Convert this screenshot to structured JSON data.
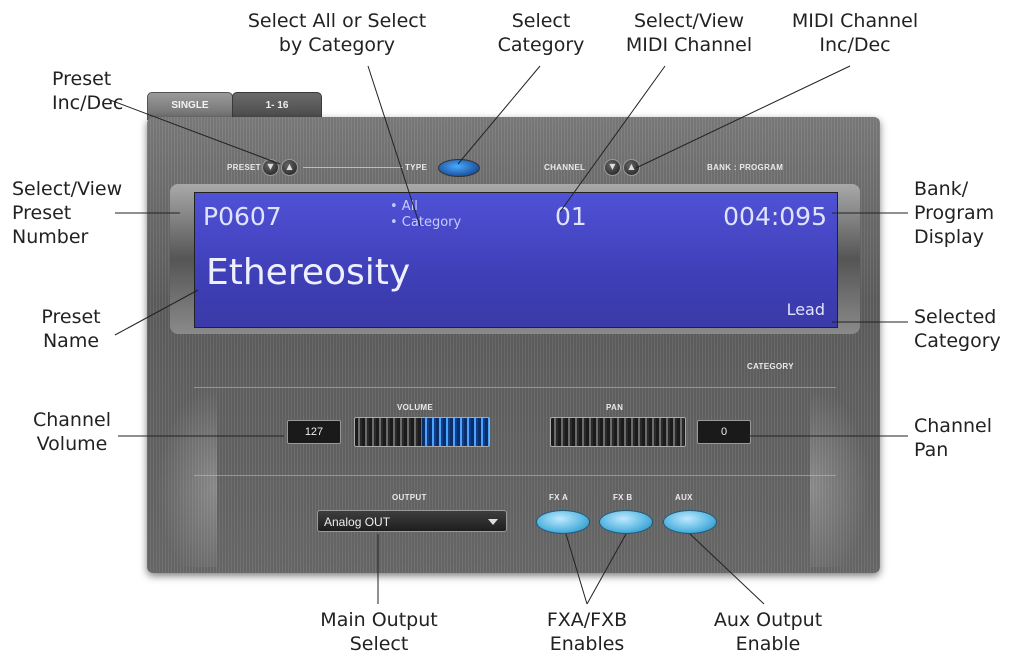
{
  "callouts": {
    "select_all": [
      "Select All or Select",
      "by Category"
    ],
    "select_category": [
      "Select",
      "Category"
    ],
    "select_midi": [
      "Select/View",
      "MIDI Channel"
    ],
    "midi_incdec": [
      "MIDI Channel",
      "Inc/Dec"
    ],
    "preset_incdec": [
      "Preset",
      "Inc/Dec"
    ],
    "select_preset": [
      "Select/View",
      "Preset",
      "Number"
    ],
    "bank_program": [
      "Bank/",
      "Program",
      "Display"
    ],
    "preset_name": [
      "Preset",
      "Name"
    ],
    "selected_category": [
      "Selected",
      "Category"
    ],
    "channel_volume": [
      "Channel",
      "Volume"
    ],
    "channel_pan": [
      "Channel",
      "Pan"
    ],
    "main_output": [
      "Main Output",
      "Select"
    ],
    "fx_enables": [
      "FXA/FXB",
      "Enables"
    ],
    "aux_output": [
      "Aux Output",
      "Enable"
    ]
  },
  "tabs": [
    "SINGLE",
    "1- 16"
  ],
  "labels": {
    "preset": "PRESET",
    "type": "TYPE",
    "channel": "CHANNEL",
    "bank_program": "BANK : PROGRAM",
    "category": "CATEGORY",
    "volume": "VOLUME",
    "pan": "PAN",
    "output": "OUTPUT",
    "fxa": "FX A",
    "fxb": "FX B",
    "aux": "AUX"
  },
  "lcd": {
    "preset_number": "P0607",
    "type_all": "• All",
    "type_category": "• Category",
    "midi_channel": "01",
    "bank_program": "004:095",
    "preset_name": "Ethereosity",
    "category": "Lead"
  },
  "controls": {
    "volume_value": "127",
    "volume_level": 0.5,
    "pan_value": "0",
    "output_selected": "Analog OUT"
  }
}
